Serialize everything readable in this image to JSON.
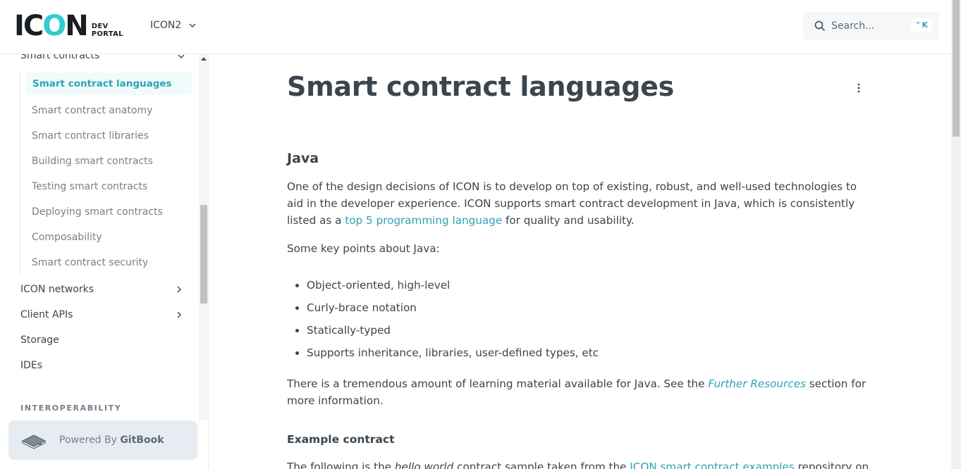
{
  "header": {
    "logo_main": "ICON",
    "logo_sub_1": "DEV",
    "logo_sub_2": "PORTAL",
    "version": "ICON2",
    "search_placeholder": "Search...",
    "search_shortcut": "⌃K"
  },
  "sidebar": {
    "top_item": "Smart contracts",
    "sub_items": [
      {
        "label": "Smart contract languages",
        "active": true
      },
      {
        "label": "Smart contract anatomy"
      },
      {
        "label": "Smart contract libraries"
      },
      {
        "label": "Building smart contracts"
      },
      {
        "label": "Testing smart contracts"
      },
      {
        "label": "Deploying smart contracts"
      },
      {
        "label": "Composability"
      },
      {
        "label": "Smart contract security"
      }
    ],
    "nav_items": [
      {
        "label": "ICON networks",
        "expandable": true
      },
      {
        "label": "Client APIs",
        "expandable": true
      },
      {
        "label": "Storage"
      },
      {
        "label": "IDEs"
      }
    ],
    "section_label": "INTEROPERABILITY",
    "powered_by_prefix": "Powered By ",
    "powered_by_brand": "GitBook"
  },
  "content": {
    "title": "Smart contract languages",
    "section_heading": "Java",
    "para1_a": "One of the design decisions of ICON is to develop on top of existing, robust, and well-used technologies to aid in the developer experience. ICON supports smart contract development in Java, which is consistently listed as a ",
    "para1_link": "top 5 programming language",
    "para1_b": " for quality and usability.",
    "para2": "Some key points about Java:",
    "bullets": [
      "Object-oriented, high-level",
      "Curly-brace notation",
      "Statically-typed",
      "Supports inheritance, libraries, user-defined types, etc"
    ],
    "para3_a": "There is a tremendous amount of learning material available for Java. See the ",
    "para3_link": "Further Resources",
    "para3_b": " section for more information.",
    "subheading": "Example contract",
    "para4_a": "The following is the ",
    "para4_em": "hello world",
    "para4_b": " contract sample taken from the ",
    "para4_link": "ICON smart contract examples",
    "para4_c": " repository on"
  },
  "colors": {
    "accent": "#2fa3b3",
    "logo_accent": "#2fccd3",
    "text": "#3b454e",
    "muted": "#74818d"
  }
}
